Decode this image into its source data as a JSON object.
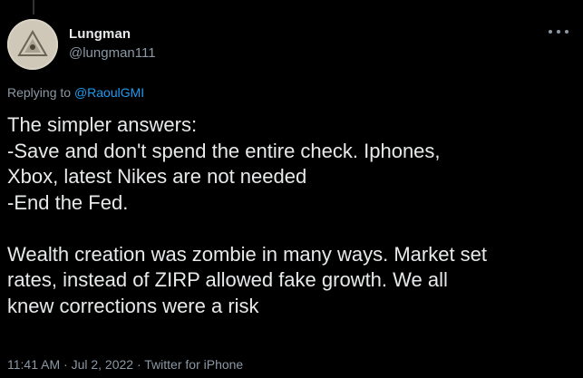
{
  "tweet": {
    "display_name": "Lungman",
    "handle": "@lungman111",
    "reply_prefix": "Replying to ",
    "reply_to": "@RaoulGMI",
    "body_lines": [
      "The simpler answers:",
      "-Save and don't spend the entire check. Iphones,",
      "Xbox, latest Nikes are not needed",
      "-End the Fed."
    ],
    "body_lines_2": [
      "Wealth creation was zombie in many ways. Market set",
      "rates, instead of ZIRP allowed fake growth. We all",
      "knew corrections were a risk"
    ],
    "time": "11:41 AM",
    "separator": " · ",
    "date": "Jul 2, 2022",
    "source": "Twitter for iPhone"
  },
  "icons": {
    "avatar": "triangle-logo-avatar",
    "more": "more-options-icon"
  },
  "colors": {
    "background": "#000000",
    "text": "#e7e9ea",
    "muted": "#8b98a5",
    "link": "#1d9bf0"
  }
}
